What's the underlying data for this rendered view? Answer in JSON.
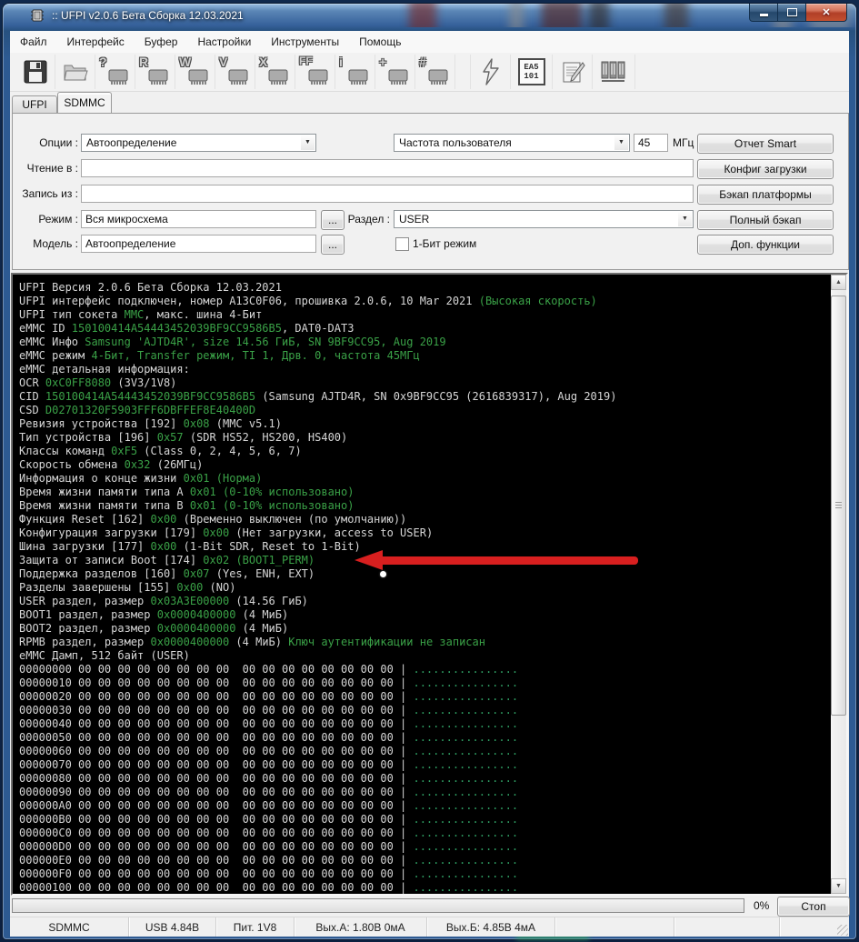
{
  "window": {
    "title": ":: UFPI v2.0.6 Бета Сборка 12.03.2021",
    "close_glyph": "✕"
  },
  "menu": {
    "items": [
      "Файл",
      "Интерфейс",
      "Буфер",
      "Настройки",
      "Инструменты",
      "Помощь"
    ]
  },
  "toolbar": {
    "chips": [
      "?",
      "R",
      "W",
      "V",
      "X",
      "FF",
      "i",
      "+",
      "#"
    ],
    "adapter_line1": "EA5",
    "adapter_line2": "101"
  },
  "tabs": {
    "items": [
      "UFPI",
      "SDMMC"
    ],
    "active": "SDMMC"
  },
  "form": {
    "options_label": "Опции :",
    "options_value": "Автоопределение",
    "freq_value": "Частота пользователя",
    "freq_num": "45",
    "freq_unit": "МГц",
    "read_label": "Чтение в :",
    "read_value": "",
    "write_label": "Запись из :",
    "write_value": "",
    "mode_label": "Режим :",
    "mode_value": "Вся микросхема",
    "partition_label": "Раздел :",
    "partition_value": "USER",
    "model_label": "Модель :",
    "model_value": "Автоопределение",
    "onebit_label": "1-Бит режим",
    "ellipsis": "...",
    "buttons": [
      "Отчет Smart",
      "Конфиг загрузки",
      "Бэкап платформы",
      "Полный бэкап",
      "Доп. функции"
    ]
  },
  "terminal": {
    "colors": {
      "w": "#d6d6d6",
      "g": "#3aa147",
      "d": "#2f9e63"
    },
    "lines": [
      [
        [
          "w",
          "UFPI Версия 2.0.6 Бета Сборка 12.03.2021"
        ]
      ],
      [
        [
          "w",
          "UFPI интерфейс подключен, номер A13C0F06, прошивка 2.0.6, 10 Mar 2021 "
        ],
        [
          "g",
          "(Высокая скорость)"
        ]
      ],
      [
        [
          "w",
          "UFPI тип сокета "
        ],
        [
          "g",
          "MMC"
        ],
        [
          "w",
          ", макс. шина 4-Бит"
        ]
      ],
      [
        [
          "w",
          "eMMC ID "
        ],
        [
          "g",
          "150100414A54443452039BF9CC9586B5"
        ],
        [
          "w",
          ", DAT0-DAT3"
        ]
      ],
      [
        [
          "w",
          "eMMC Инфо "
        ],
        [
          "g",
          "Samsung 'AJTD4R', size 14.56 ГиБ, SN 9BF9CC95, Aug 2019"
        ]
      ],
      [
        [
          "w",
          "eMMC режим "
        ],
        [
          "g",
          "4-Бит, Transfer режим, TI 1, Дрв. 0, частота 45МГц"
        ]
      ],
      [
        [
          "w",
          "eMMC детальная информация:"
        ]
      ],
      [
        [
          "w",
          "OCR "
        ],
        [
          "g",
          "0xC0FF8080"
        ],
        [
          "w",
          " (3V3/1V8)"
        ]
      ],
      [
        [
          "w",
          "CID "
        ],
        [
          "g",
          "150100414A54443452039BF9CC9586B5"
        ],
        [
          "w",
          " (Samsung AJTD4R, SN 0x9BF9CC95 (2616839317), Aug 2019)"
        ]
      ],
      [
        [
          "w",
          "CSD "
        ],
        [
          "g",
          "D02701320F5903FFF6DBFFEF8E40400D"
        ]
      ],
      [
        [
          "w",
          "Ревизия устройства [192] "
        ],
        [
          "g",
          "0x08"
        ],
        [
          "w",
          " (MMC v5.1)"
        ]
      ],
      [
        [
          "w",
          "Тип устройства [196] "
        ],
        [
          "g",
          "0x57"
        ],
        [
          "w",
          " (SDR HS52, HS200, HS400)"
        ]
      ],
      [
        [
          "w",
          "Классы команд "
        ],
        [
          "g",
          "0xF5"
        ],
        [
          "w",
          " (Class 0, 2, 4, 5, 6, 7)"
        ]
      ],
      [
        [
          "w",
          "Скорость обмена "
        ],
        [
          "g",
          "0x32"
        ],
        [
          "w",
          " (26МГц)"
        ]
      ],
      [
        [
          "w",
          "Информация о конце жизни "
        ],
        [
          "g",
          "0x01"
        ],
        [
          "w",
          " "
        ],
        [
          "g",
          "(Норма)"
        ]
      ],
      [
        [
          "w",
          "Время жизни памяти типа A "
        ],
        [
          "g",
          "0x01"
        ],
        [
          "w",
          " "
        ],
        [
          "g",
          "(0-10% использовано)"
        ]
      ],
      [
        [
          "w",
          "Время жизни памяти типа B "
        ],
        [
          "g",
          "0x01"
        ],
        [
          "w",
          " "
        ],
        [
          "g",
          "(0-10% использовано)"
        ]
      ],
      [
        [
          "w",
          "Функция Reset [162] "
        ],
        [
          "g",
          "0x00"
        ],
        [
          "w",
          " (Временно выключен (по умолчанию))"
        ]
      ],
      [
        [
          "w",
          "Конфигурация загрузки [179] "
        ],
        [
          "g",
          "0x00"
        ],
        [
          "w",
          " (Нет загрузки, access to USER)"
        ]
      ],
      [
        [
          "w",
          "Шина загрузки [177] "
        ],
        [
          "g",
          "0x00"
        ],
        [
          "w",
          " (1-Bit SDR, Reset to 1-Bit)"
        ]
      ],
      [
        [
          "w",
          "Защита от записи Boot [174] "
        ],
        [
          "g",
          "0x02"
        ],
        [
          "w",
          " "
        ],
        [
          "g",
          "(BOOT1_PERM)"
        ]
      ],
      [
        [
          "w",
          "Поддержка разделов [160] "
        ],
        [
          "g",
          "0x07"
        ],
        [
          "w",
          " (Yes, ENH, EXT)"
        ]
      ],
      [
        [
          "w",
          "Разделы завершены [155] "
        ],
        [
          "g",
          "0x00"
        ],
        [
          "w",
          " (NO)"
        ]
      ],
      [
        [
          "w",
          "USER раздел, размер "
        ],
        [
          "g",
          "0x03A3E00000"
        ],
        [
          "w",
          " (14.56 ГиБ)"
        ]
      ],
      [
        [
          "w",
          "BOOT1 раздел, размер "
        ],
        [
          "g",
          "0x0000400000"
        ],
        [
          "w",
          " (4 МиБ)"
        ]
      ],
      [
        [
          "w",
          "BOOT2 раздел, размер "
        ],
        [
          "g",
          "0x0000400000"
        ],
        [
          "w",
          " (4 МиБ)"
        ]
      ],
      [
        [
          "w",
          "RPMB раздел, размер "
        ],
        [
          "g",
          "0x0000400000"
        ],
        [
          "w",
          " (4 МиБ) "
        ],
        [
          "g",
          "Ключ аутентификации не записан"
        ]
      ],
      [
        [
          "w",
          "eMMC Дамп, 512 байт (USER)"
        ]
      ],
      [
        [
          "w",
          "00000000 00 00 00 00 00 00 00 00  00 00 00 00 00 00 00 00 | "
        ],
        [
          "d",
          "................"
        ]
      ],
      [
        [
          "w",
          "00000010 00 00 00 00 00 00 00 00  00 00 00 00 00 00 00 00 | "
        ],
        [
          "d",
          "................"
        ]
      ],
      [
        [
          "w",
          "00000020 00 00 00 00 00 00 00 00  00 00 00 00 00 00 00 00 | "
        ],
        [
          "d",
          "................"
        ]
      ],
      [
        [
          "w",
          "00000030 00 00 00 00 00 00 00 00  00 00 00 00 00 00 00 00 | "
        ],
        [
          "d",
          "................"
        ]
      ],
      [
        [
          "w",
          "00000040 00 00 00 00 00 00 00 00  00 00 00 00 00 00 00 00 | "
        ],
        [
          "d",
          "................"
        ]
      ],
      [
        [
          "w",
          "00000050 00 00 00 00 00 00 00 00  00 00 00 00 00 00 00 00 | "
        ],
        [
          "d",
          "................"
        ]
      ],
      [
        [
          "w",
          "00000060 00 00 00 00 00 00 00 00  00 00 00 00 00 00 00 00 | "
        ],
        [
          "d",
          "................"
        ]
      ],
      [
        [
          "w",
          "00000070 00 00 00 00 00 00 00 00  00 00 00 00 00 00 00 00 | "
        ],
        [
          "d",
          "................"
        ]
      ],
      [
        [
          "w",
          "00000080 00 00 00 00 00 00 00 00  00 00 00 00 00 00 00 00 | "
        ],
        [
          "d",
          "................"
        ]
      ],
      [
        [
          "w",
          "00000090 00 00 00 00 00 00 00 00  00 00 00 00 00 00 00 00 | "
        ],
        [
          "d",
          "................"
        ]
      ],
      [
        [
          "w",
          "000000A0 00 00 00 00 00 00 00 00  00 00 00 00 00 00 00 00 | "
        ],
        [
          "d",
          "................"
        ]
      ],
      [
        [
          "w",
          "000000B0 00 00 00 00 00 00 00 00  00 00 00 00 00 00 00 00 | "
        ],
        [
          "d",
          "................"
        ]
      ],
      [
        [
          "w",
          "000000C0 00 00 00 00 00 00 00 00  00 00 00 00 00 00 00 00 | "
        ],
        [
          "d",
          "................"
        ]
      ],
      [
        [
          "w",
          "000000D0 00 00 00 00 00 00 00 00  00 00 00 00 00 00 00 00 | "
        ],
        [
          "d",
          "................"
        ]
      ],
      [
        [
          "w",
          "000000E0 00 00 00 00 00 00 00 00  00 00 00 00 00 00 00 00 | "
        ],
        [
          "d",
          "................"
        ]
      ],
      [
        [
          "w",
          "000000F0 00 00 00 00 00 00 00 00  00 00 00 00 00 00 00 00 | "
        ],
        [
          "d",
          "................"
        ]
      ],
      [
        [
          "w",
          "00000100 00 00 00 00 00 00 00 00  00 00 00 00 00 00 00 00 | "
        ],
        [
          "d",
          "................"
        ]
      ]
    ]
  },
  "annotation": {
    "arrow_color": "#d81f1f"
  },
  "progress": {
    "value": "0%",
    "stop_label": "Стоп"
  },
  "statusbar": {
    "items": [
      "SDMMC",
      "USB 4.84В",
      "Пит. 1V8",
      "Вых.А: 1.80В 0мА",
      "Вых.Б: 4.85В 4мА"
    ]
  }
}
